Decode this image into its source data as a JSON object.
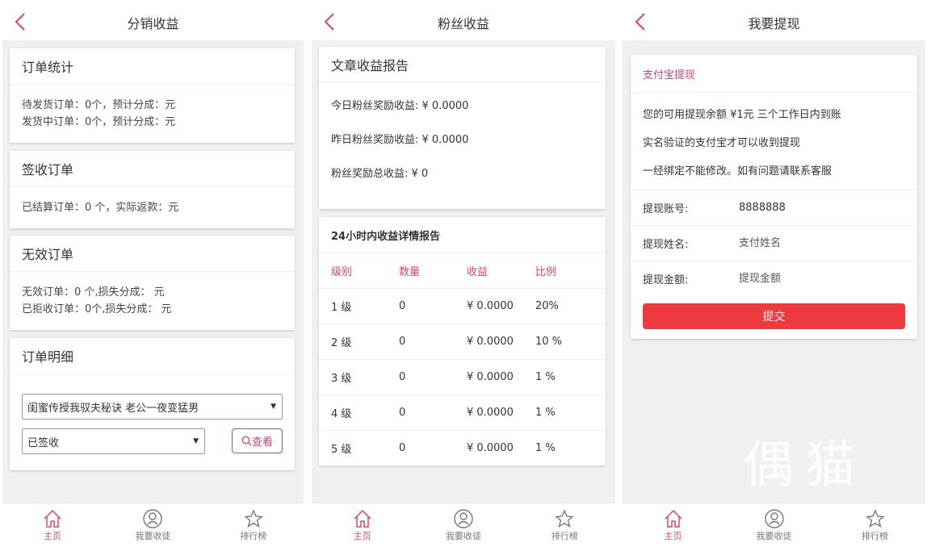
{
  "screens": {
    "distribution": {
      "title": "分销收益",
      "order_stats": {
        "title": "订单统计",
        "line1": "待发货订单：0个，预计分成：元",
        "line2": "发货中订单：0个，预计分成：元"
      },
      "signed_orders": {
        "title": "签收订单",
        "line1": "已结算订单：0 个，实际返款：元"
      },
      "invalid_orders": {
        "title": "无效订单",
        "line1": "无效订单：0 个,损失分成： 元",
        "line2": "已拒收订单：0个,损失分成： 元"
      },
      "order_detail": {
        "title": "订单明细",
        "product_select": "闺蜜传授我驭夫秘诀 老公一夜变猛男",
        "status_select": "已签收",
        "view_button": "查看"
      }
    },
    "fans": {
      "title": "粉丝收益",
      "report": {
        "title": "文章收益报告",
        "today": "今日粉丝奖励收益: ¥ 0.0000",
        "yesterday": "昨日粉丝奖励收益: ¥ 0.0000",
        "total": "粉丝奖励总收益: ¥ 0"
      },
      "detail": {
        "title": "24小时内收益详情报告",
        "headers": [
          "级别",
          "数量",
          "收益",
          "比例"
        ],
        "rows": [
          [
            "1 级",
            "0",
            "¥ 0.0000",
            "20%"
          ],
          [
            "2 级",
            "0",
            "¥ 0.0000",
            "10 %"
          ],
          [
            "3 级",
            "0",
            "¥ 0.0000",
            "1 %"
          ],
          [
            "4 级",
            "0",
            "¥ 0.0000",
            "1 %"
          ],
          [
            "5 级",
            "0",
            "¥ 0.0000",
            "1 %"
          ]
        ]
      }
    },
    "withdraw": {
      "title": "我要提现",
      "section_title": "支付宝提现",
      "info1": "您的可用提现余额 ¥1元 三个工作日内到账",
      "info2": "实名验证的支付宝才可以收到提现",
      "info3": "一经绑定不能修改。如有问题请联系客服",
      "account_label": "提现账号:",
      "account_value": "8888888",
      "name_label": "提现姓名:",
      "name_placeholder": "支付姓名",
      "amount_label": "提现金额:",
      "amount_placeholder": "提现金额",
      "submit": "提交",
      "watermark": "偶猫"
    }
  },
  "tabbar": {
    "home": "主页",
    "disciples": "我要收徒",
    "ranking": "排行榜"
  },
  "colors": {
    "accent": "#e04565",
    "submit": "#ee3a3f",
    "background": "#f0f0f2"
  },
  "icons": {
    "back": "chevron-left-icon",
    "home": "home-icon",
    "disciples": "user-circle-icon",
    "ranking": "star-icon",
    "search": "search-icon"
  }
}
